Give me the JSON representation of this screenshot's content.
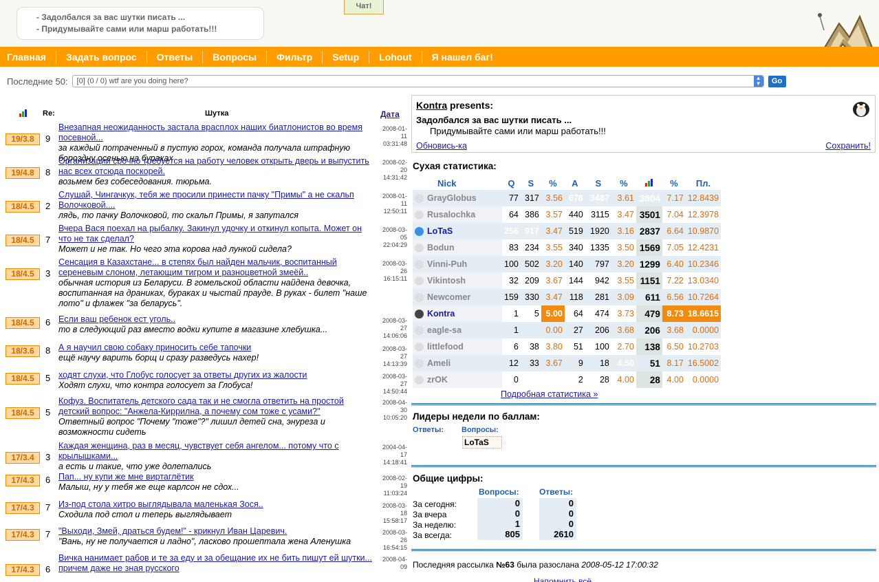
{
  "header": {
    "slogan_lines": [
      "- Задолбался за вас шутки писать ...",
      "- Придумывайте сами или марш работать!!!"
    ],
    "chat_label": "Чат!"
  },
  "nav": [
    "Главная",
    "Задать вопрос",
    "Ответы",
    "Вопросы",
    "Фильтр",
    "Setup",
    "Lohout",
    "Я нашел баг!"
  ],
  "recent": {
    "label": "Последние 50:",
    "selected": "[0] (0 / 0) wtf are you doing here?",
    "go_label": "Go"
  },
  "list_header": {
    "re": "Re:",
    "joke": "Шутка",
    "date": "Дата"
  },
  "jokes": [
    {
      "score": "19/3.8",
      "re": "9",
      "title": "Внезапная неожиданность застала врасплох наших биатлонистов во время посевной...",
      "answer": "за каждый потраченный в пустую горох, команда получала штрафную бороздну осенью на бураках",
      "date": [
        "2008-01-",
        "11",
        "03:31:48"
      ]
    },
    {
      "score": "19/4.8",
      "re": "8",
      "title": "Организации срочно требуется на работу человек открыть дверь и выпустить нас всех отсюда поскорей.",
      "answer": "возьмем без собеседования. тюрьма.",
      "date": [
        "2008-02-",
        "20",
        "14:31:42"
      ]
    },
    {
      "score": "18/4.5",
      "re": "2",
      "title": "Слушай, Чингачкук, тебя же просили принести пачку \"Примы\" а не скальп Волочковой....",
      "answer": "лядь, то пачку Волочковой, то скальп Примы, я запутался",
      "date": [
        "2008-01-",
        "11",
        "12:50:11"
      ]
    },
    {
      "score": "18/4.5",
      "re": "7",
      "title": "Вчера Вася поехал на рыбалку. Закинул удочку и откинул копыта. Может он что не так сделал?",
      "answer": "Может и не так. Но чего эта корова над лункой сидела?",
      "date": [
        "2008-03-",
        "05",
        "22:04:29"
      ]
    },
    {
      "score": "18/4.5",
      "re": "3",
      "title": "Сенсация в Казахстане... в степях был найден мальчик, воспитанный сереневым слоном, летающим тигром и разноцветной змеёй..",
      "answer": "обычная история из Беларуси. В гомельской области найдена девочка, воспитанная на драниках, бураках и чыстай прауде. В руках - билет \"наше лото\" и флажек \"за беларусь\".",
      "date": [
        "2008-03-",
        "26",
        "16:15:11"
      ]
    },
    {
      "score": "18/4.5",
      "re": "6",
      "title": "Если ваш ребенок ест уголь..",
      "answer": "то в следующий раз вместо водки купите в магазине хлебушка...",
      "date": [
        "2008-03-",
        "27",
        "14:06:06"
      ]
    },
    {
      "score": "18/3.6",
      "re": "8",
      "title": "А я научил свою собаку приносить себе тапочки",
      "answer": "ещё научу варить борщ и сразу разведусь нахер!",
      "date": [
        "2008-03-",
        "27",
        "14:13:39"
      ]
    },
    {
      "score": "18/4.5",
      "re": "5",
      "title": "ходят слухи, что Глобус голосует за ответы других из жалости",
      "answer": "Ходят слухи, что контра голосует за Глобуса!",
      "date": [
        "2008-03-",
        "27",
        "14:50:44"
      ]
    },
    {
      "score": "18/4.5",
      "re": "5",
      "title": "Кофуз. Воспитатель детского сада так и не смогла ответить на простой детский вопрос: \"Анжела-Киррилна, а почему сом тоже с усами?\"",
      "answer": "Ответный вопрос \"Почему \"тоже\"?\" лишил детей сна, энуреза и возможности сидеть",
      "date": [
        "2008-04-",
        "30",
        "10:05:20"
      ]
    },
    {
      "score": "17/3.4",
      "re": "3",
      "title": "Каждая женщина, раз в месяц, чувствует себя ангелом... потому что с крылышками...",
      "answer": "а есть и такие, что уже долетались",
      "date": [
        "2004-04-",
        "17",
        "14:18:41"
      ]
    },
    {
      "score": "17/4.3",
      "re": "6",
      "title": "Пап... ну купи же мне виртаглётик",
      "answer": "Малыш, ну у тебя же еще карлсон не сдох...",
      "date": [
        "2008-02-",
        "19",
        "11:03:24"
      ]
    },
    {
      "score": "17/4.3",
      "re": "7",
      "title": "Из-под стола хитро выглядывала маленькая Зося..",
      "answer": "Сходила под стол и теперь выглядывает",
      "date": [
        "2008-03-",
        "18",
        "15:58:17"
      ]
    },
    {
      "score": "17/4.3",
      "re": "7",
      "title": "\"Выходи, Змей, драться будем!\" - крикнул Иван Царевич.",
      "answer": "\"Вань, ну не получается и ладно\", ласково прошептала жена Аленушка",
      "date": [
        "2008-03-",
        "26",
        "16:54:15"
      ]
    },
    {
      "score": "17/4.3",
      "re": "6",
      "title": "Вичка нанимает рабов и те за еду и за обещание их не бить пишут ей шутки... причем даже не зная русского",
      "answer": "",
      "date": [
        "2008-04-",
        "09",
        ""
      ]
    }
  ],
  "presents": {
    "author": "Kontra",
    "suffix": " presents:",
    "line1": "Задолбался за вас шутки писать ...",
    "line2": "Придумывайте сами или марш работать!!!",
    "refresh": "Обновись-ка",
    "save": "Сохранить!"
  },
  "stats": {
    "title": "Сухая статистика:",
    "headers": [
      "Nick",
      "Q",
      "S",
      "%",
      "A",
      "S",
      "%",
      "",
      "%",
      "Пл."
    ],
    "rows": [
      [
        "GrayGlobus",
        "77",
        "317",
        "3.56",
        "678",
        "3487",
        "3.61",
        "3804",
        "7.17",
        "12.8439"
      ],
      [
        "Rusalochka",
        "64",
        "386",
        "3.57",
        "440",
        "3115",
        "3.47",
        "3501",
        "7.04",
        "12.3978"
      ],
      [
        "LoTaS",
        "256",
        "917",
        "3.47",
        "519",
        "1920",
        "3.16",
        "2837",
        "6.64",
        "10.9870"
      ],
      [
        "Bodun",
        "83",
        "234",
        "3.55",
        "340",
        "1335",
        "3.50",
        "1569",
        "7.05",
        "12.4231"
      ],
      [
        "Vinni-Puh",
        "100",
        "502",
        "3.20",
        "140",
        "797",
        "3.20",
        "1299",
        "6.40",
        "10.2346"
      ],
      [
        "Vikintosh",
        "32",
        "209",
        "3.67",
        "144",
        "942",
        "3.55",
        "1151",
        "7.22",
        "13.0340"
      ],
      [
        "Newcomer",
        "159",
        "330",
        "3.47",
        "118",
        "281",
        "3.09",
        "611",
        "6.56",
        "10.7264"
      ],
      [
        "Kontra",
        "1",
        "5",
        "5.00",
        "64",
        "474",
        "3.73",
        "479",
        "8.73",
        "18.6615"
      ],
      [
        "eagle-sa",
        "1",
        "",
        "0.00",
        "27",
        "206",
        "3.68",
        "206",
        "3.68",
        "0.0000"
      ],
      [
        "littlefood",
        "6",
        "38",
        "3.80",
        "51",
        "100",
        "2.70",
        "138",
        "6.50",
        "10.2703"
      ],
      [
        "Ameli",
        "12",
        "33",
        "3.67",
        "9",
        "18",
        "4.50",
        "51",
        "8.17",
        "16.5002"
      ],
      [
        "zrOK",
        "0",
        "",
        "",
        "2",
        "28",
        "4.00",
        "28",
        "4.00",
        "0.0000"
      ]
    ],
    "more": "Подробная статистика »"
  },
  "leaders": {
    "title": "Лидеры недели по баллам:",
    "answers_label": "Ответы:",
    "questions_label": "Вопросы:",
    "questions_leader": "LoTaS"
  },
  "totals": {
    "title": "Общие цифры:",
    "q_label": "Вопросы:",
    "a_label": "Ответы:",
    "rows": [
      {
        "label": "За сегодня:",
        "q": "0",
        "a": "0"
      },
      {
        "label": "За вчера",
        "q": "0",
        "a": "0"
      },
      {
        "label": "За неделю:",
        "q": "1",
        "a": "0"
      },
      {
        "label": "За всегда:",
        "q": "805",
        "a": "2610"
      }
    ]
  },
  "mailing": {
    "prefix": "Последняя рассылка ",
    "num": "№63",
    "mid": " была разослана ",
    "date": "2008-05-12 17:00:32",
    "remind": "Напомнить всё"
  }
}
